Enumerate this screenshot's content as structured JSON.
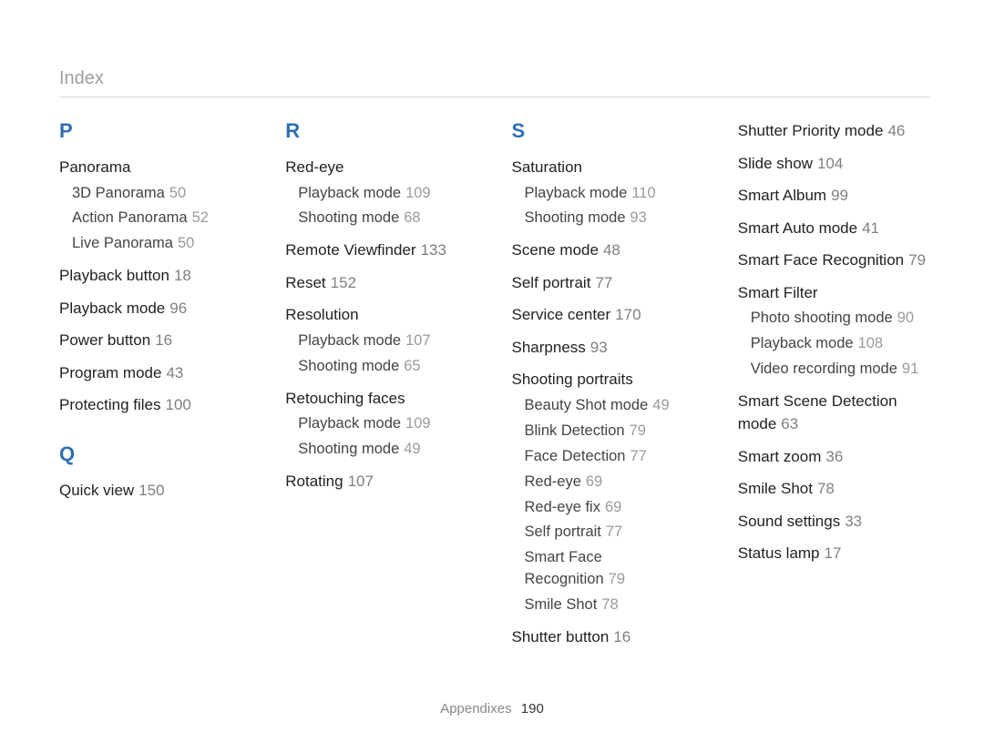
{
  "header": "Index",
  "footer": {
    "label": "Appendixes",
    "page": "190"
  },
  "columns": [
    {
      "sections": [
        {
          "letter": "P",
          "entries": [
            {
              "term": "Panorama",
              "subs": [
                {
                  "term": "3D Panorama",
                  "page": "50"
                },
                {
                  "term": "Action Panorama",
                  "page": "52"
                },
                {
                  "term": "Live Panorama",
                  "page": "50"
                }
              ]
            },
            {
              "term": "Playback button",
              "page": "18"
            },
            {
              "term": "Playback mode",
              "page": "96"
            },
            {
              "term": "Power button",
              "page": "16"
            },
            {
              "term": "Program mode",
              "page": "43"
            },
            {
              "term": "Protecting files",
              "page": "100"
            }
          ]
        },
        {
          "letter": "Q",
          "entries": [
            {
              "term": "Quick view",
              "page": "150"
            }
          ]
        }
      ]
    },
    {
      "sections": [
        {
          "letter": "R",
          "entries": [
            {
              "term": "Red-eye",
              "subs": [
                {
                  "term": "Playback mode",
                  "page": "109"
                },
                {
                  "term": "Shooting mode",
                  "page": "68"
                }
              ]
            },
            {
              "term": "Remote Viewfinder",
              "page": "133"
            },
            {
              "term": "Reset",
              "page": "152"
            },
            {
              "term": "Resolution",
              "subs": [
                {
                  "term": "Playback mode",
                  "page": "107"
                },
                {
                  "term": "Shooting mode",
                  "page": "65"
                }
              ]
            },
            {
              "term": "Retouching faces",
              "subs": [
                {
                  "term": "Playback mode",
                  "page": "109"
                },
                {
                  "term": "Shooting mode",
                  "page": "49"
                }
              ]
            },
            {
              "term": "Rotating",
              "page": "107"
            }
          ]
        }
      ]
    },
    {
      "sections": [
        {
          "letter": "S",
          "entries": [
            {
              "term": "Saturation",
              "subs": [
                {
                  "term": "Playback mode",
                  "page": "110"
                },
                {
                  "term": "Shooting mode",
                  "page": "93"
                }
              ]
            },
            {
              "term": "Scene mode",
              "page": "48"
            },
            {
              "term": "Self portrait",
              "page": "77"
            },
            {
              "term": "Service center",
              "page": "170"
            },
            {
              "term": "Sharpness",
              "page": "93"
            },
            {
              "term": "Shooting portraits",
              "subs": [
                {
                  "term": "Beauty Shot mode",
                  "page": "49"
                },
                {
                  "term": "Blink Detection",
                  "page": "79"
                },
                {
                  "term": "Face Detection",
                  "page": "77"
                },
                {
                  "term": "Red-eye",
                  "page": "69"
                },
                {
                  "term": "Red-eye fix",
                  "page": "69"
                },
                {
                  "term": "Self portrait",
                  "page": "77"
                },
                {
                  "term": "Smart Face Recognition",
                  "page": "79"
                },
                {
                  "term": "Smile Shot",
                  "page": "78"
                }
              ]
            },
            {
              "term": "Shutter button",
              "page": "16"
            }
          ]
        }
      ]
    },
    {
      "sections": [
        {
          "entries": [
            {
              "term": "Shutter Priority mode",
              "page": "46"
            },
            {
              "term": "Slide show",
              "page": "104"
            },
            {
              "term": "Smart Album",
              "page": "99"
            },
            {
              "term": "Smart Auto mode",
              "page": "41"
            },
            {
              "term": "Smart Face Recognition",
              "page": "79"
            },
            {
              "term": "Smart Filter",
              "subs": [
                {
                  "term": "Photo shooting mode",
                  "page": "90"
                },
                {
                  "term": "Playback mode",
                  "page": "108"
                },
                {
                  "term": "Video recording mode",
                  "page": "91"
                }
              ]
            },
            {
              "term": "Smart Scene Detection mode",
              "page": "63"
            },
            {
              "term": "Smart zoom",
              "page": "36"
            },
            {
              "term": "Smile Shot",
              "page": "78"
            },
            {
              "term": "Sound settings",
              "page": "33"
            },
            {
              "term": "Status lamp",
              "page": "17"
            }
          ]
        }
      ]
    }
  ]
}
